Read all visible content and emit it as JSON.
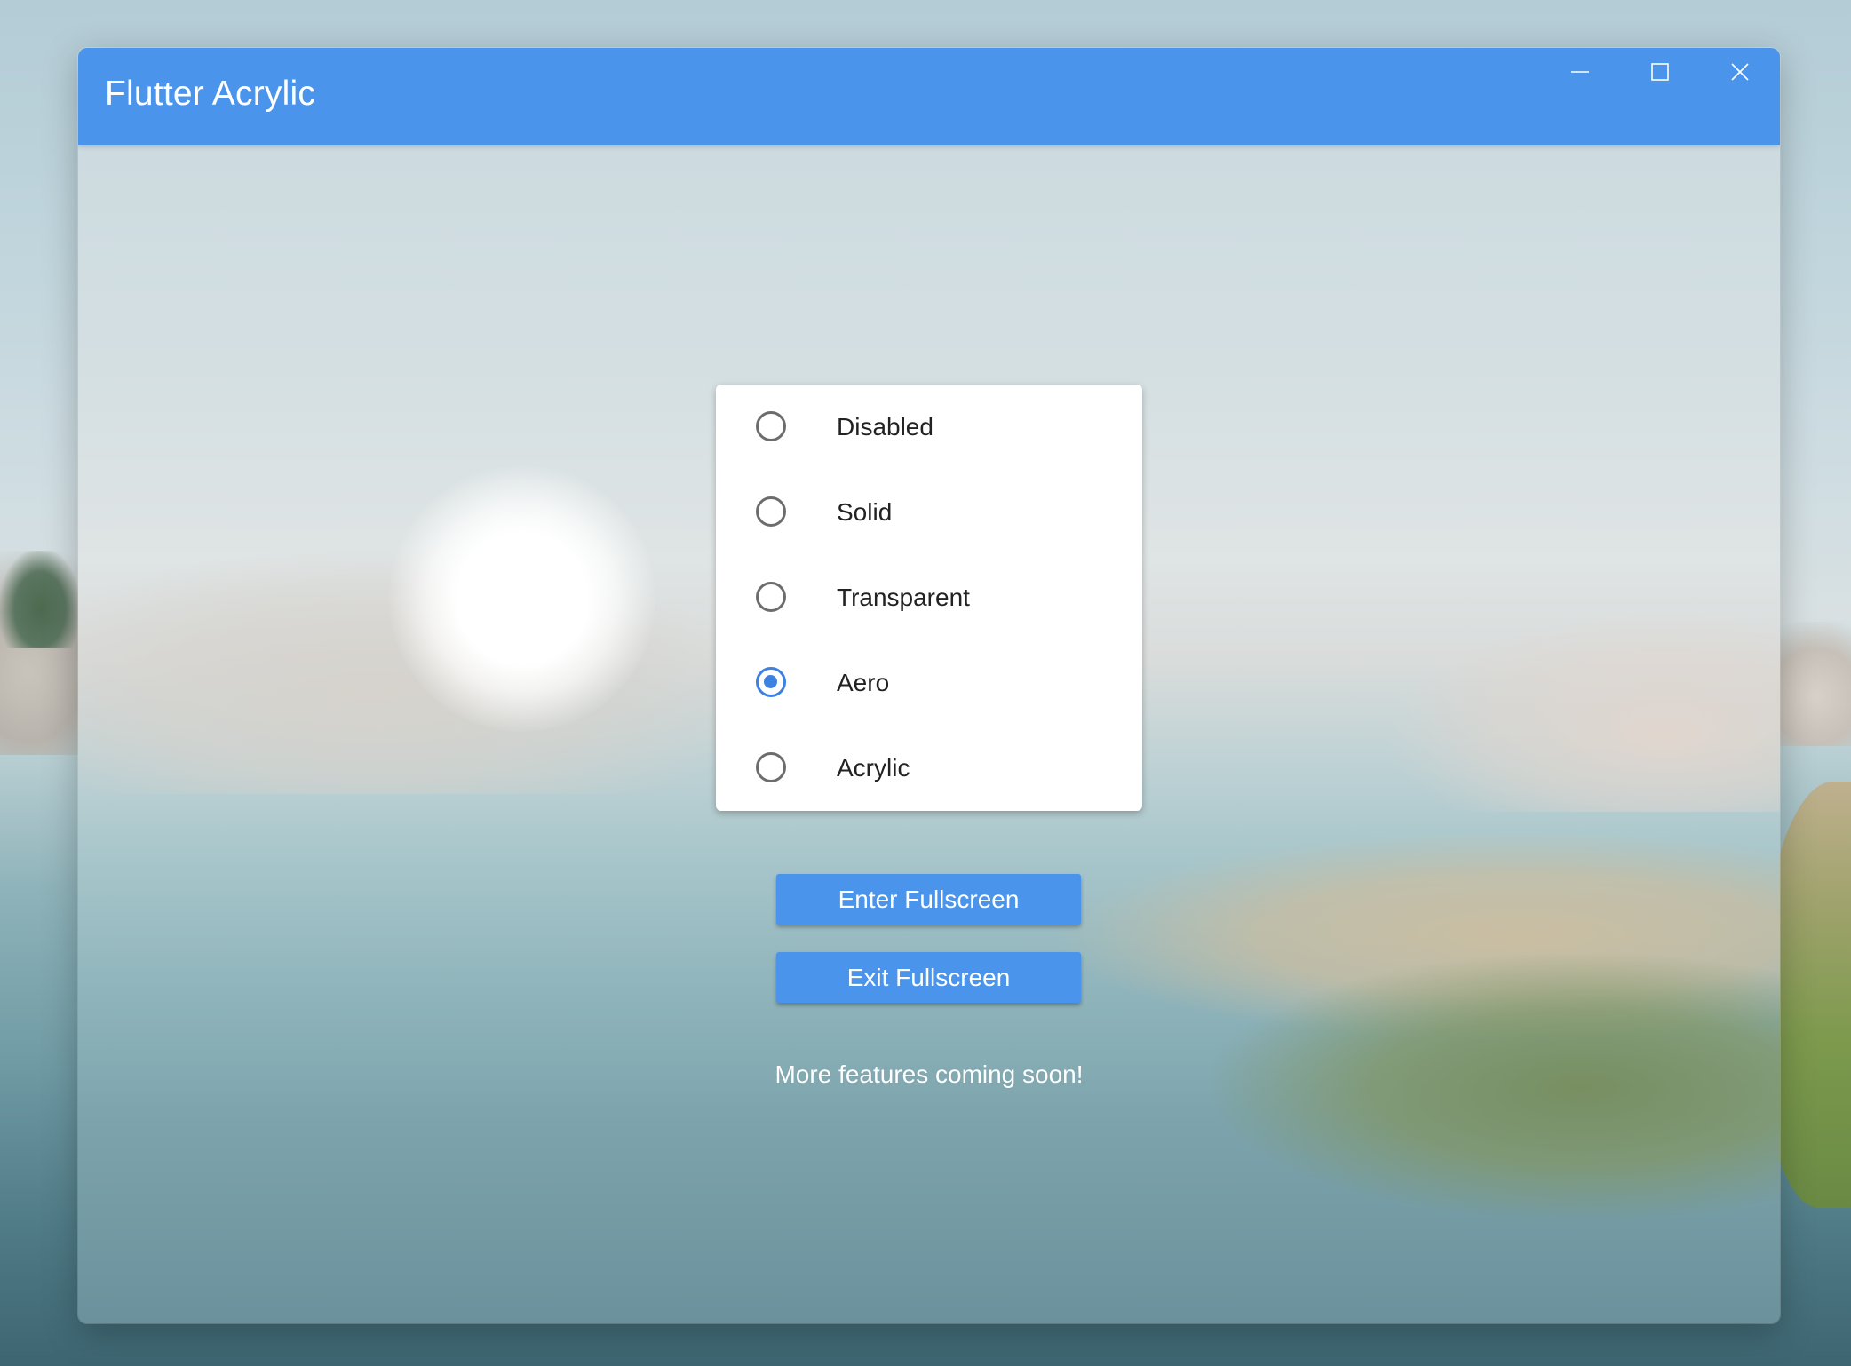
{
  "window": {
    "title": "Flutter Acrylic",
    "controls": {
      "minimize_icon": "minimize-icon",
      "maximize_icon": "maximize-icon",
      "close_icon": "close-icon"
    }
  },
  "effects": {
    "options": [
      {
        "label": "Disabled",
        "selected": false
      },
      {
        "label": "Solid",
        "selected": false
      },
      {
        "label": "Transparent",
        "selected": false
      },
      {
        "label": "Aero",
        "selected": true
      },
      {
        "label": "Acrylic",
        "selected": false
      }
    ],
    "selected": "Aero"
  },
  "actions": {
    "enter_fullscreen": "Enter Fullscreen",
    "exit_fullscreen": "Exit Fullscreen"
  },
  "footer": {
    "note": "More features coming soon!"
  },
  "colors": {
    "titlebar": "#4a94eb",
    "button": "#4a94eb",
    "radio_selected": "#3d82e0",
    "radio_unselected": "#6d6d6d"
  }
}
